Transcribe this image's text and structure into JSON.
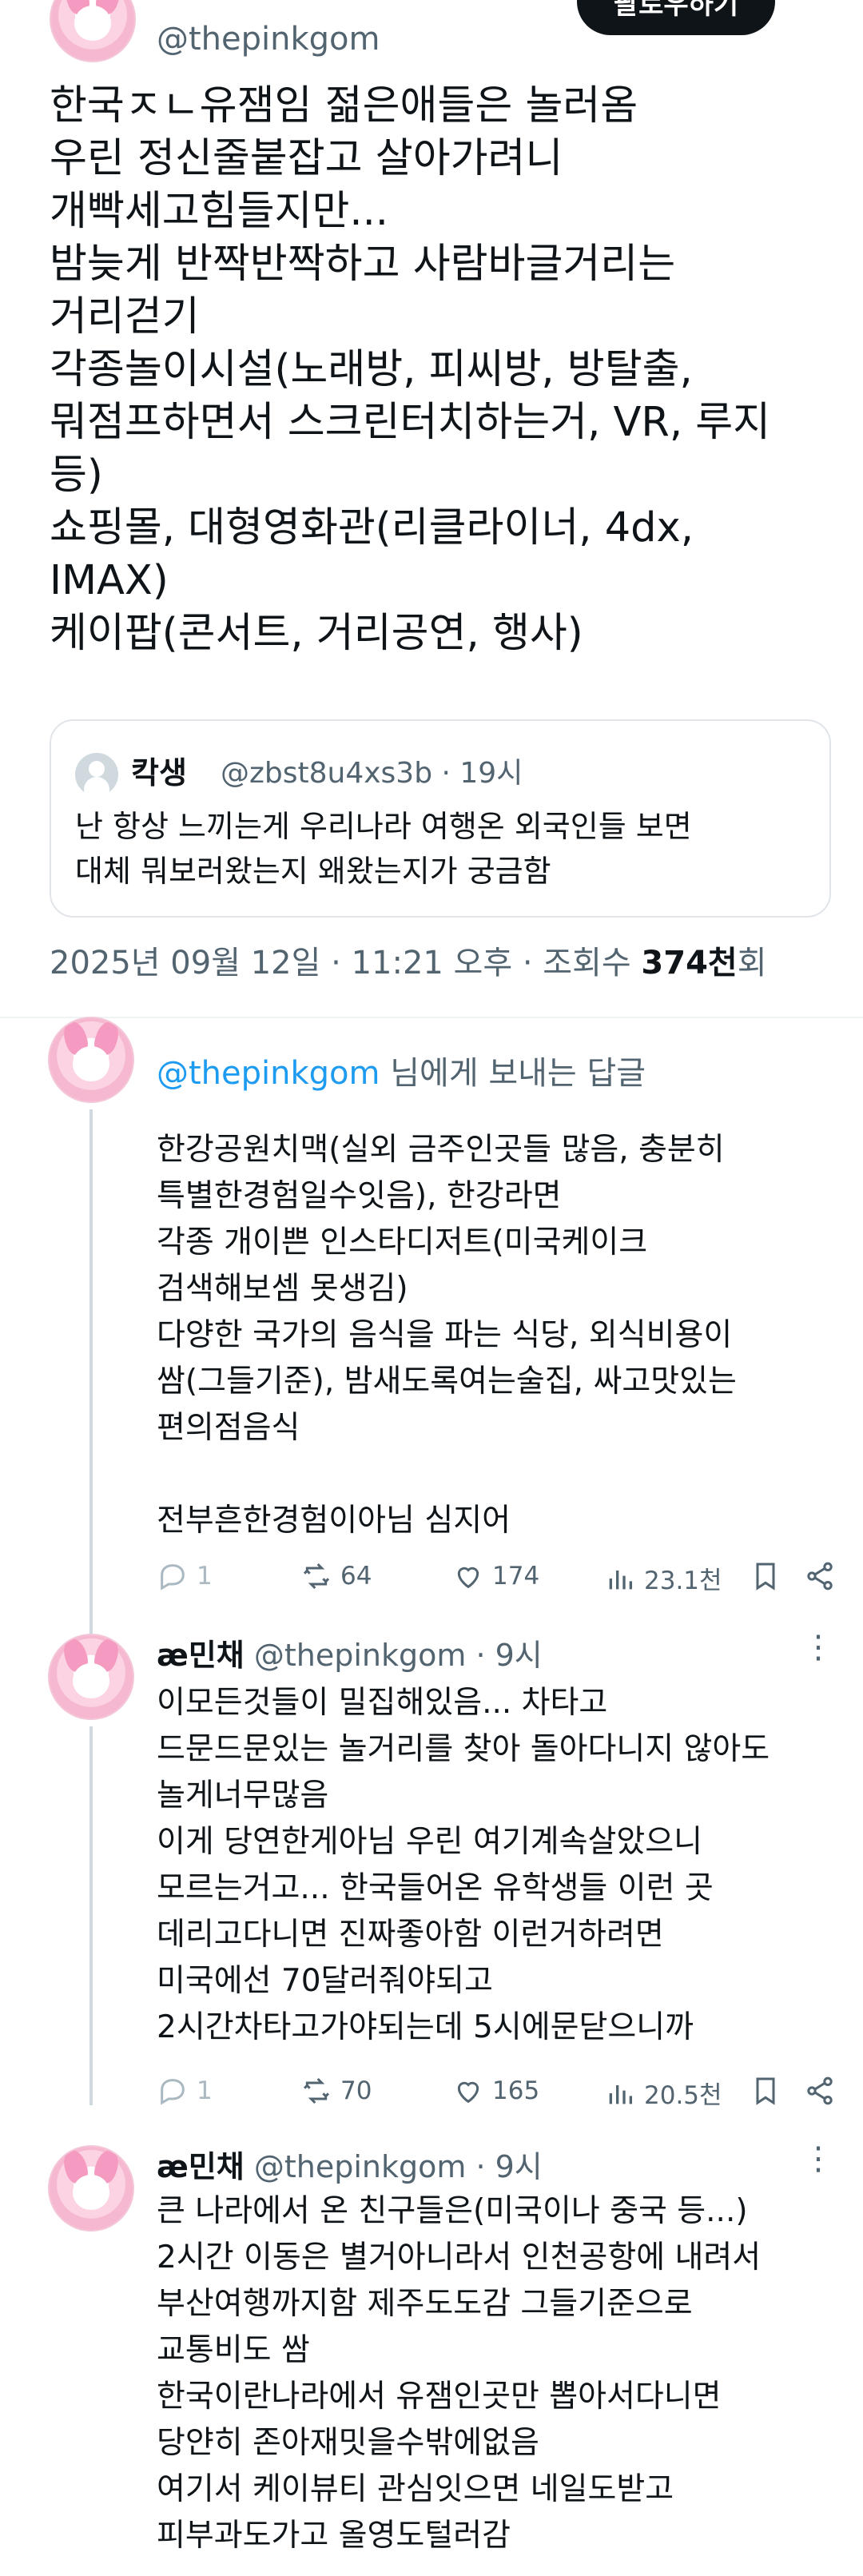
{
  "top_post": {
    "handle": "@thepinkgom",
    "follow_label": "팔로우하기",
    "lines": [
      "한국ㅈㄴ유잼임 젊은애들은 놀러옴",
      "우린 정신줄붙잡고 살아가려니",
      "개빡세고힘들지만...",
      "밤늦게 반짝반짝하고 사람바글거리는",
      "거리걷기",
      "각종놀이시설(노래방, 피씨방, 방탈출,",
      "뭐점프하면서 스크린터치하는거, VR, 루지",
      "등)",
      "쇼핑몰, 대형영화관(리클라이너, 4dx,",
      "IMAX)",
      "케이팝(콘서트, 거리공연, 행사)"
    ],
    "quote": {
      "name": "칵생",
      "meta": "@zbst8u4xs3b · 19시",
      "lines": [
        "난 항상 느끼는게 우리나라 여행온 외국인들 보면",
        "대체 뭐보러왔는지 왜왔는지가 궁금함"
      ]
    },
    "timestamp": "2025년 09월 12일 · 11:21 오후 · 조회수 ",
    "views_number": "374천",
    "views_suffix": "회"
  },
  "replies": [
    {
      "replying_mention": "@thepinkgom",
      "replying_suffix": " 님에게 보내는 답글",
      "lines": [
        "한강공원치맥(실외 금주인곳들 많음, 충분히",
        "특별한경험일수잇음), 한강라면",
        "각종 개이쁜 인스타디저트(미국케이크",
        "검색해보셈 못생김)",
        "다양한 국가의 음식을 파는 식당, 외식비용이",
        "쌈(그들기준), 밤새도록여는술집, 싸고맛있는",
        "편의점음식",
        "",
        "전부흔한경험이아님 심지어"
      ],
      "stats": {
        "replies": "1",
        "retweets": "64",
        "likes": "174",
        "views": "23.1천"
      }
    },
    {
      "name": "æ민채",
      "handle": "@thepinkgom · 9시",
      "lines": [
        "이모든것들이 밀집해있음... 차타고",
        "드문드문있는 놀거리를 찾아 돌아다니지 않아도",
        "놀게너무많음",
        "이게 당연한게아님 우린 여기계속살았으니",
        "모르는거고... 한국들어온 유학생들 이런 곳",
        "데리고다니면 진짜좋아함 이런거하려면",
        "미국에선 70달러줘야되고",
        "2시간차타고가야되는데 5시에문닫으니까"
      ],
      "stats": {
        "replies": "1",
        "retweets": "70",
        "likes": "165",
        "views": "20.5천"
      }
    },
    {
      "name": "æ민채",
      "handle": "@thepinkgom · 9시",
      "lines": [
        "큰 나라에서 온 친구들은(미국이나 중국 등...)",
        "2시간 이동은 별거아니라서 인천공항에 내려서",
        "부산여행까지함 제주도도감 그들기준으로",
        "교통비도 쌈",
        "한국이란나라에서 유잼인곳만 뽑아서다니면",
        "당얀히 존아재밋을수밖에없음",
        "여기서 케이뷰티 관심잇으면 네일도받고",
        "피부과도가고 올영도털러감"
      ]
    }
  ],
  "more_label": "⋮",
  "icons": [
    "reply-icon",
    "retweet-icon",
    "like-icon",
    "views-icon",
    "bookmark-icon",
    "share-icon",
    "more-icon"
  ]
}
